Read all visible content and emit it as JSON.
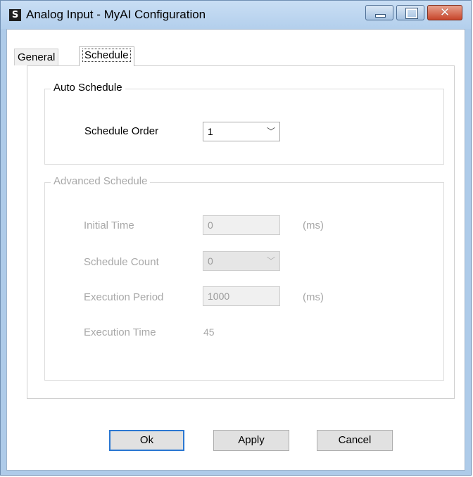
{
  "window": {
    "title": "Analog Input -  MyAI Configuration",
    "icon_glyph": "S",
    "controls": {
      "minimize": "minimize",
      "maximize": "maximize",
      "close_glyph": "✕"
    }
  },
  "tabs": [
    {
      "label": "General",
      "active": false
    },
    {
      "label": "Schedule",
      "active": true
    }
  ],
  "auto_schedule": {
    "legend": "Auto Schedule",
    "schedule_order_label": "Schedule Order",
    "schedule_order_value": "1"
  },
  "advanced_schedule": {
    "legend": "Advanced Schedule",
    "enabled": false,
    "initial_time_label": "Initial Time",
    "initial_time_value": "0",
    "initial_time_unit": "(ms)",
    "schedule_count_label": "Schedule Count",
    "schedule_count_value": "0",
    "execution_period_label": "Execution Period",
    "execution_period_value": "1000",
    "execution_period_unit": "(ms)",
    "execution_time_label": "Execution Time",
    "execution_time_value": "45"
  },
  "buttons": {
    "ok": "Ok",
    "apply": "Apply",
    "cancel": "Cancel"
  },
  "icons": {
    "dropdown": "chevron-down-icon",
    "chevron_glyph": "﹀"
  },
  "colors": {
    "titlebar": "#b3cfec",
    "close_button": "#c7452b",
    "disabled_text": "#a8a8a8",
    "focus_border": "#2a77d2"
  }
}
